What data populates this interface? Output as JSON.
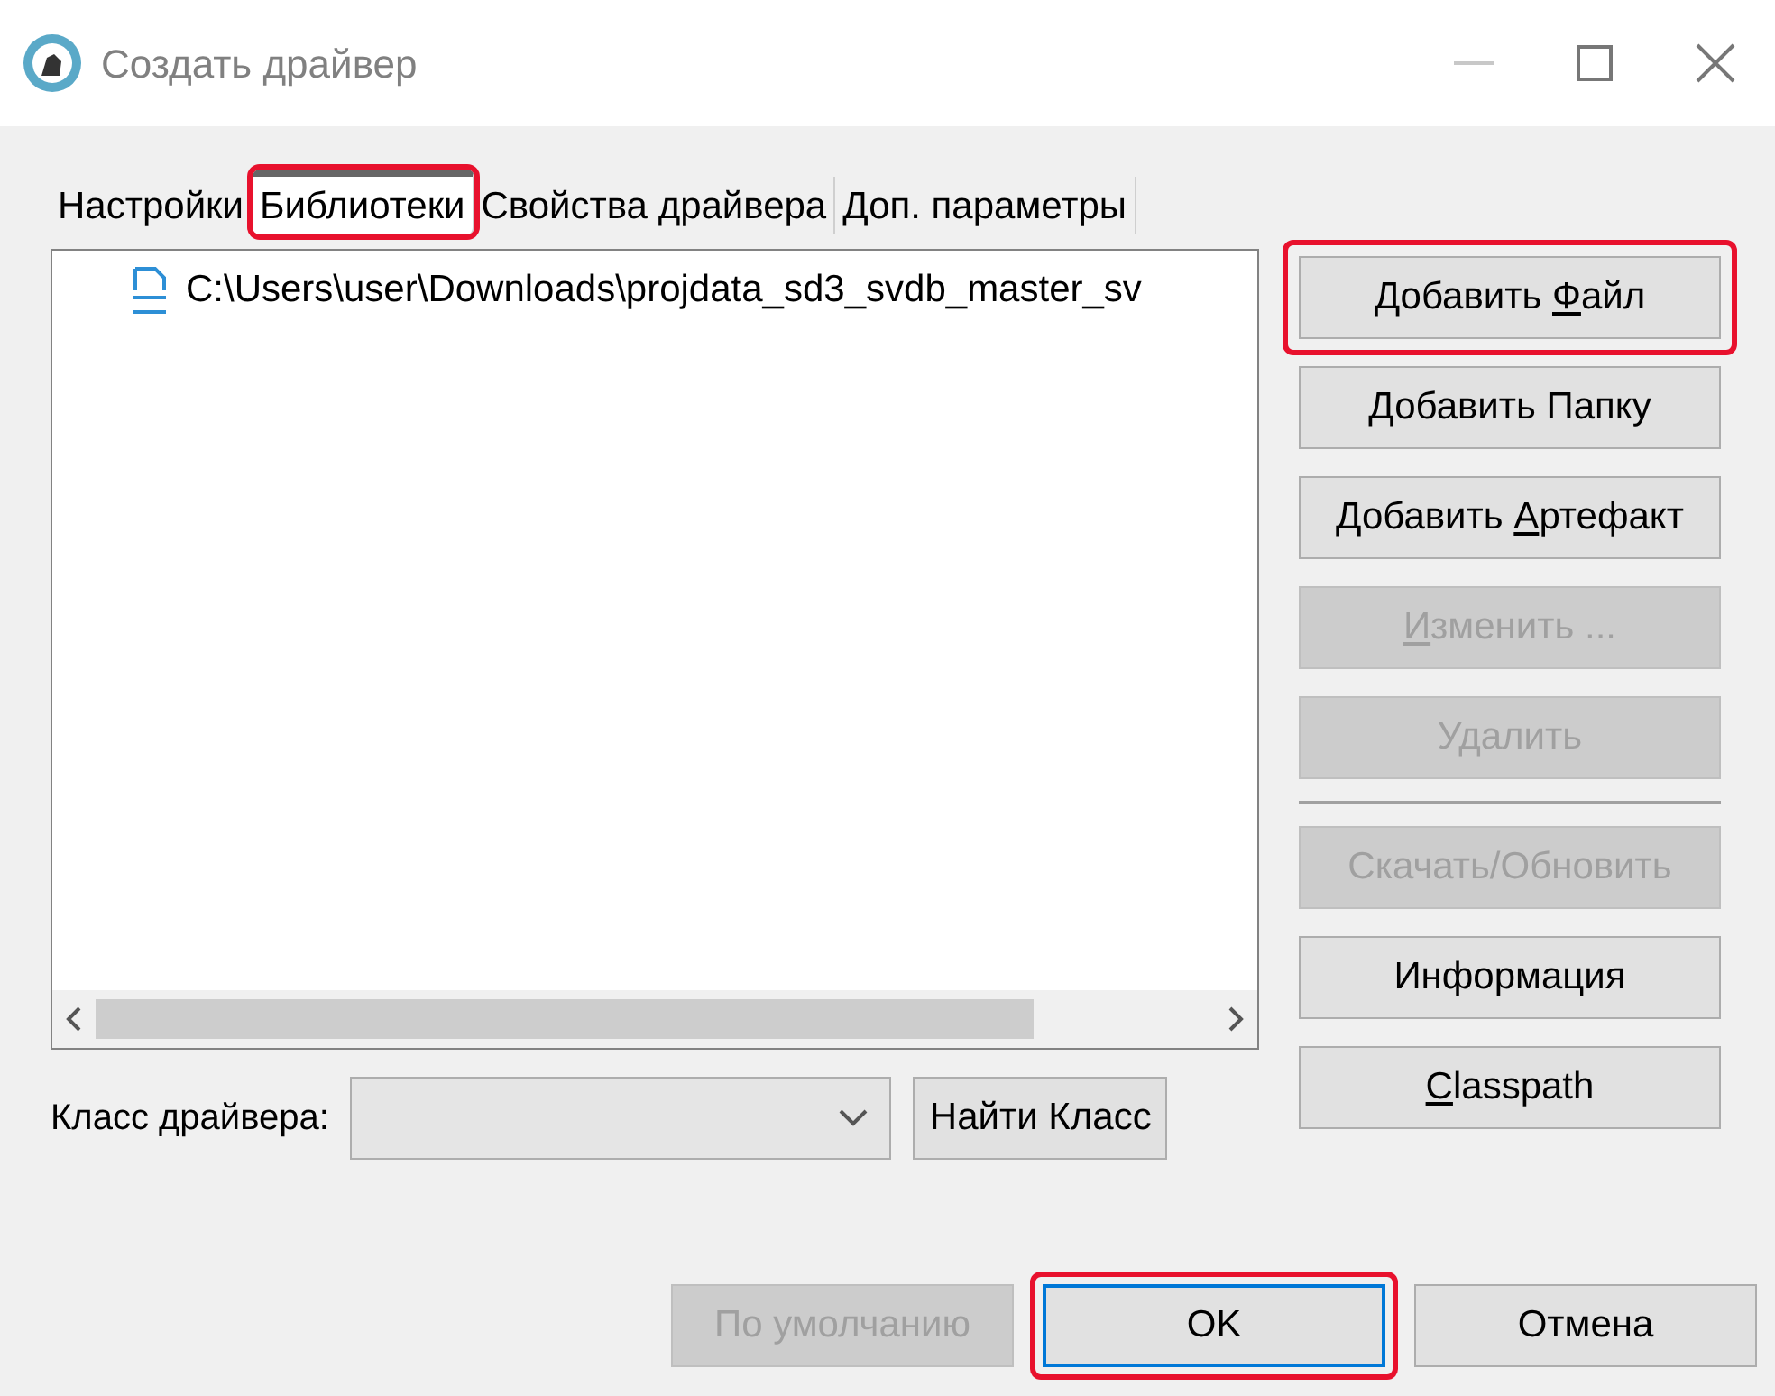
{
  "window": {
    "title": "Создать драйвер"
  },
  "tabs": [
    {
      "label": "Настройки",
      "selected": false,
      "highlighted": false
    },
    {
      "label": "Библиотеки",
      "selected": true,
      "highlighted": true
    },
    {
      "label": "Свойства драйвера",
      "selected": false,
      "highlighted": false
    },
    {
      "label": "Доп. параметры",
      "selected": false,
      "highlighted": false
    }
  ],
  "libraries": [
    {
      "path": "C:\\Users\\user\\Downloads\\projdata_sd3_svdb_master_sv"
    }
  ],
  "side_buttons": [
    {
      "kind": "button",
      "label_before": "Добавить ",
      "key": "Ф",
      "label_after": "айл",
      "disabled": false,
      "highlighted": true
    },
    {
      "kind": "button",
      "label_before": "Добавить Папку",
      "disabled": false,
      "highlighted": false
    },
    {
      "kind": "button",
      "label_before": "Добавить ",
      "key": "А",
      "label_after": "ртефакт",
      "disabled": false,
      "highlighted": false
    },
    {
      "kind": "button",
      "key": "И",
      "label_after": "зменить ...",
      "disabled": true,
      "highlighted": false
    },
    {
      "kind": "button",
      "label_before": "Удалить",
      "disabled": true,
      "highlighted": false
    },
    {
      "kind": "separator"
    },
    {
      "kind": "button",
      "label_before": "Скачать/Обновить",
      "disabled": true,
      "highlighted": false
    },
    {
      "kind": "button",
      "label_before": "Информация",
      "disabled": false,
      "highlighted": false
    },
    {
      "kind": "button",
      "key": "C",
      "label_after": "lasspath",
      "disabled": false,
      "highlighted": false
    }
  ],
  "driver_class": {
    "label": "Класс драйвера:",
    "find_button": "Найти Класс"
  },
  "footer_buttons": [
    {
      "label": "По умолчанию",
      "disabled": true,
      "highlighted": false,
      "focused": false
    },
    {
      "label": "OK",
      "disabled": false,
      "highlighted": true,
      "focused": true
    },
    {
      "label": "Отмена",
      "disabled": false,
      "highlighted": false,
      "focused": false
    }
  ]
}
